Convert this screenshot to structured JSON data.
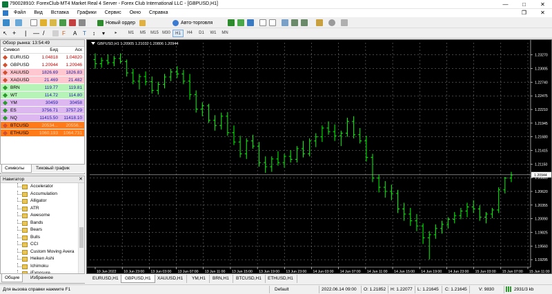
{
  "window": {
    "title": "790028910: ForexClub-MT4 Market Real 4 Server - Forex Club International LLC - [GBPUSD,H1]",
    "minimize": "—",
    "maximize": "□",
    "close": "✕"
  },
  "menu": [
    "Файл",
    "Вид",
    "Вставка",
    "Графики",
    "Сервис",
    "Окно",
    "Справка"
  ],
  "toolbar": {
    "new_order": "Новый ордер",
    "auto_trading": "Авто-торговля",
    "timeframes": [
      "M1",
      "M5",
      "M15",
      "M30",
      "H1",
      "H4",
      "D1",
      "W1",
      "MN"
    ],
    "active_timeframe": "H1"
  },
  "market_watch": {
    "title": "Обзор рынка: 13:54:49",
    "columns": {
      "symbol": "Символ",
      "bid": "Бид",
      "ask": "Аск"
    },
    "rows": [
      {
        "symbol": "EURUSD",
        "bid": "1.04818",
        "ask": "1.04820",
        "bg": "#ffffff",
        "fg": "#c00000",
        "icon": "#d05030"
      },
      {
        "symbol": "GBPUSD",
        "bid": "1.20944",
        "ask": "1.20946",
        "bg": "#ffffff",
        "fg": "#c00000",
        "icon": "#d05030"
      },
      {
        "symbol": "XAUUSD",
        "bid": "1826.69",
        "ask": "1826.83",
        "bg": "#ffc8d0",
        "fg": "#1a1aa0",
        "icon": "#d05030"
      },
      {
        "symbol": "XAGUSD",
        "bid": "21.469",
        "ask": "21.482",
        "bg": "#ffc8d0",
        "fg": "#1a1aa0",
        "icon": "#d05030"
      },
      {
        "symbol": "BRN",
        "bid": "119.77",
        "ask": "119.81",
        "bg": "#b6f3b6",
        "fg": "#1a1aa0",
        "icon": "#2a9a2a"
      },
      {
        "symbol": "WT",
        "bid": "114.72",
        "ask": "114.80",
        "bg": "#b6f3b6",
        "fg": "#1a1aa0",
        "icon": "#2a9a2a"
      },
      {
        "symbol": "YM",
        "bid": "30459",
        "ask": "30458",
        "bg": "#ddb8f0",
        "fg": "#1a1aa0",
        "icon": "#2a9a2a"
      },
      {
        "symbol": "ES",
        "bid": "3756.71",
        "ask": "3757.29",
        "bg": "#ddb8f0",
        "fg": "#1a1aa0",
        "icon": "#2a9a2a"
      },
      {
        "symbol": "NQ",
        "bid": "11415.50",
        "ask": "11418.10",
        "bg": "#ddb8f0",
        "fg": "#1a1aa0",
        "icon": "#2a9a2a"
      },
      {
        "symbol": "BTCUSD",
        "bid": "20534...",
        "ask": "20556...",
        "bg": "#ff7b1a",
        "fg": "#ffd3a8",
        "icon": "#d05030"
      },
      {
        "symbol": "ETHUSD",
        "bid": "1060.193",
        "ask": "1064.731",
        "bg": "#ff7b1a",
        "fg": "#ffd3a8",
        "icon": "#d05030"
      }
    ],
    "tabs": [
      "Символы",
      "Тиковый график"
    ]
  },
  "navigator": {
    "title": "Навигатор",
    "items": [
      "Accelerator",
      "Accumulation",
      "Alligator",
      "ATR",
      "Awesome",
      "Bands",
      "Bears",
      "Bulls",
      "CCI",
      "Custom Moving Avera",
      "Heiken Ashi",
      "Ichimoku",
      "iExposure"
    ],
    "tabs": [
      "Общие",
      "Избранное"
    ]
  },
  "chart": {
    "symbol_info": "GBPUSD,H1  1.20905 1.21032 1.20806 1.20944",
    "current_price": "1.20944",
    "price_axis": [
      "1.23270",
      "1.23005",
      "1.22740",
      "1.22475",
      "1.22210",
      "1.21945",
      "1.21680",
      "1.21415",
      "1.21150",
      "1.20885",
      "1.20620",
      "1.20355",
      "1.20090",
      "1.19825",
      "1.19560",
      "1.19295"
    ],
    "time_axis": [
      "10 Jun 2022",
      "10 Jun 23:00",
      "13 Jun 03:00",
      "13 Jun 07:00",
      "13 Jun 11:00",
      "13 Jun 15:00",
      "13 Jun 19:00",
      "13 Jun 23:00",
      "14 Jun 03:00",
      "14 Jun 07:00",
      "14 Jun 11:00",
      "14 Jun 15:00",
      "14 Jun 19:00",
      "14 Jun 23:00",
      "15 Jun 03:00",
      "15 Jun 07:00",
      "15 Jun 11:00"
    ],
    "bar_color": "#00ff00",
    "ohlc": [
      [
        1.2318,
        1.233,
        1.23,
        1.231
      ],
      [
        1.231,
        1.2322,
        1.2302,
        1.2316
      ],
      [
        1.2316,
        1.2328,
        1.2308,
        1.2312
      ],
      [
        1.2312,
        1.2325,
        1.2305,
        1.232
      ],
      [
        1.232,
        1.233,
        1.231,
        1.2314
      ],
      [
        1.2314,
        1.2318,
        1.2285,
        1.2292
      ],
      [
        1.2292,
        1.23,
        1.227,
        1.2276
      ],
      [
        1.2276,
        1.229,
        1.226,
        1.2285
      ],
      [
        1.2285,
        1.2295,
        1.2268,
        1.2275
      ],
      [
        1.2275,
        1.2285,
        1.2252,
        1.2258
      ],
      [
        1.2258,
        1.2275,
        1.225,
        1.227
      ],
      [
        1.227,
        1.229,
        1.2262,
        1.2284
      ],
      [
        1.2284,
        1.23,
        1.2276,
        1.2294
      ],
      [
        1.2294,
        1.2305,
        1.2282,
        1.229
      ],
      [
        1.229,
        1.2298,
        1.227,
        1.2276
      ],
      [
        1.2276,
        1.229,
        1.224,
        1.225
      ],
      [
        1.225,
        1.2258,
        1.2215,
        1.2222
      ],
      [
        1.2222,
        1.2235,
        1.2208,
        1.2228
      ],
      [
        1.2228,
        1.2232,
        1.2195,
        1.22
      ],
      [
        1.22,
        1.221,
        1.218,
        1.219
      ],
      [
        1.219,
        1.2215,
        1.2182,
        1.2208
      ],
      [
        1.2208,
        1.2216,
        1.217,
        1.2176
      ],
      [
        1.2176,
        1.219,
        1.2152,
        1.2158
      ],
      [
        1.2158,
        1.217,
        1.2128,
        1.2135
      ],
      [
        1.2135,
        1.2165,
        1.2125,
        1.216
      ],
      [
        1.216,
        1.2172,
        1.2145,
        1.215
      ],
      [
        1.215,
        1.2158,
        1.211,
        1.2118
      ],
      [
        1.2118,
        1.213,
        1.2098,
        1.211
      ],
      [
        1.211,
        1.213,
        1.21,
        1.2125
      ],
      [
        1.2125,
        1.214,
        1.2112,
        1.2118
      ],
      [
        1.2118,
        1.2135,
        1.2108,
        1.213
      ],
      [
        1.213,
        1.2142,
        1.2118,
        1.2124
      ],
      [
        1.2124,
        1.215,
        1.2118,
        1.2145
      ],
      [
        1.2145,
        1.216,
        1.2128,
        1.2135
      ],
      [
        1.2135,
        1.2165,
        1.213,
        1.216
      ],
      [
        1.216,
        1.2175,
        1.2148,
        1.2168
      ],
      [
        1.2168,
        1.219,
        1.2158,
        1.2185
      ],
      [
        1.2185,
        1.2198,
        1.2172,
        1.2178
      ],
      [
        1.2178,
        1.2192,
        1.216,
        1.217
      ],
      [
        1.217,
        1.218,
        1.215,
        1.2175
      ],
      [
        1.2175,
        1.2205,
        1.2168,
        1.2198
      ],
      [
        1.2198,
        1.2208,
        1.2165,
        1.2172
      ],
      [
        1.2172,
        1.2185,
        1.2155,
        1.216
      ],
      [
        1.216,
        1.217,
        1.212,
        1.2128
      ],
      [
        1.2128,
        1.2135,
        1.208,
        1.2088
      ],
      [
        1.2088,
        1.2095,
        1.206,
        1.207
      ],
      [
        1.207,
        1.2082,
        1.205,
        1.2062
      ],
      [
        1.2062,
        1.2075,
        1.2045,
        1.2058
      ],
      [
        1.2058,
        1.2065,
        1.202,
        1.2028
      ],
      [
        1.2028,
        1.204,
        1.2005,
        1.2018
      ],
      [
        1.2018,
        1.203,
        1.1995,
        1.2005
      ],
      [
        1.2005,
        1.2018,
        1.1985,
        1.1995
      ],
      [
        1.1995,
        1.2,
        1.196,
        1.1972
      ],
      [
        1.1972,
        1.1985,
        1.193,
        1.1978
      ],
      [
        1.1978,
        1.1998,
        1.197,
        1.199
      ],
      [
        1.199,
        1.2005,
        1.198,
        1.1998
      ],
      [
        1.1998,
        1.2012,
        1.199,
        1.2008
      ],
      [
        1.2008,
        1.2022,
        1.2,
        1.2015
      ],
      [
        1.2015,
        1.203,
        1.2008,
        1.2024
      ],
      [
        1.2024,
        1.204,
        1.2012,
        1.2032
      ],
      [
        1.2032,
        1.2045,
        1.202,
        1.2028
      ],
      [
        1.2028,
        1.2035,
        1.2005,
        1.2012
      ],
      [
        1.2012,
        1.2022,
        1.2,
        1.2018
      ],
      [
        1.2018,
        1.203,
        1.201,
        1.2026
      ],
      [
        1.2026,
        1.207,
        1.202,
        1.2065
      ],
      [
        1.2065,
        1.209,
        1.2058,
        1.2088
      ],
      [
        1.2088,
        1.21,
        1.208,
        1.2094
      ]
    ]
  },
  "chart_tabs": [
    "EURUSD,H1",
    "GBPUSD,H1",
    "XAUUSD,H1",
    "YM,H1",
    "BRN,H1",
    "BTCUSD,H1",
    "ETHUSD,H1"
  ],
  "active_chart_tab": "GBPUSD,H1",
  "status": {
    "help": "Для вызова справки нажмите F1",
    "profile": "Default",
    "datetime": "2022.06.14 09:00",
    "open": "O: 1.21852",
    "high": "H: 1.22077",
    "low": "L: 1.21645",
    "close": "C: 1.21645",
    "volume": "V: 9830",
    "traffic": "2931/3 kb"
  }
}
